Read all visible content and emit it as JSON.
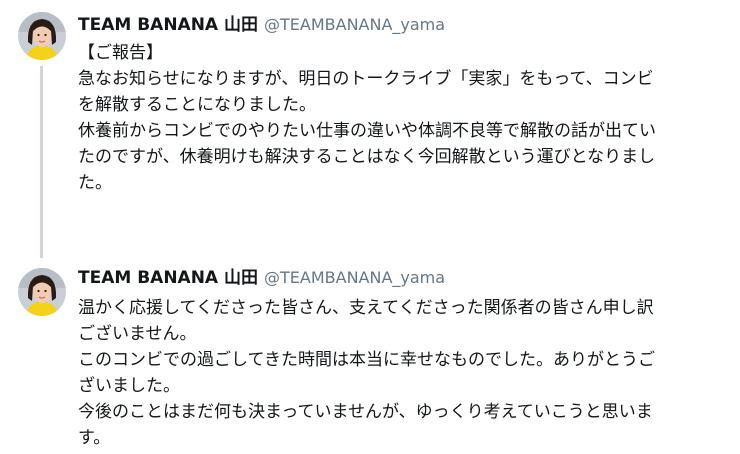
{
  "thread": {
    "tweets": [
      {
        "author": {
          "display_name": "TEAM BANANA 山田",
          "handle": "@TEAMBANANA_yama"
        },
        "lines": [
          "【ご報告】",
          "急なお知らせになりますが、明日のトークライブ「実家」をもって、コンビ",
          "を解散することになりました。",
          "休養前からコンビでのやりたい仕事の違いや体調不良等で解散の話が出てい",
          "たのですが、休養明けも解決することはなく今回解散という運びとなりまし",
          "た。"
        ]
      },
      {
        "author": {
          "display_name": "TEAM BANANA 山田",
          "handle": "@TEAMBANANA_yama"
        },
        "lines": [
          "温かく応援してくださった皆さん、支えてくださった関係者の皆さん申し訳",
          "ございません。",
          "このコンビでの過ごしてきた時間は本当に幸せなものでした。ありがとうご",
          "ざいました。",
          "今後のことはまだ何も決まっていませんが、ゆっくり考えていこうと思いま",
          "す。"
        ]
      }
    ]
  },
  "colors": {
    "text": "#14171a",
    "handle": "#657786",
    "thread_line": "#d0d6db"
  }
}
